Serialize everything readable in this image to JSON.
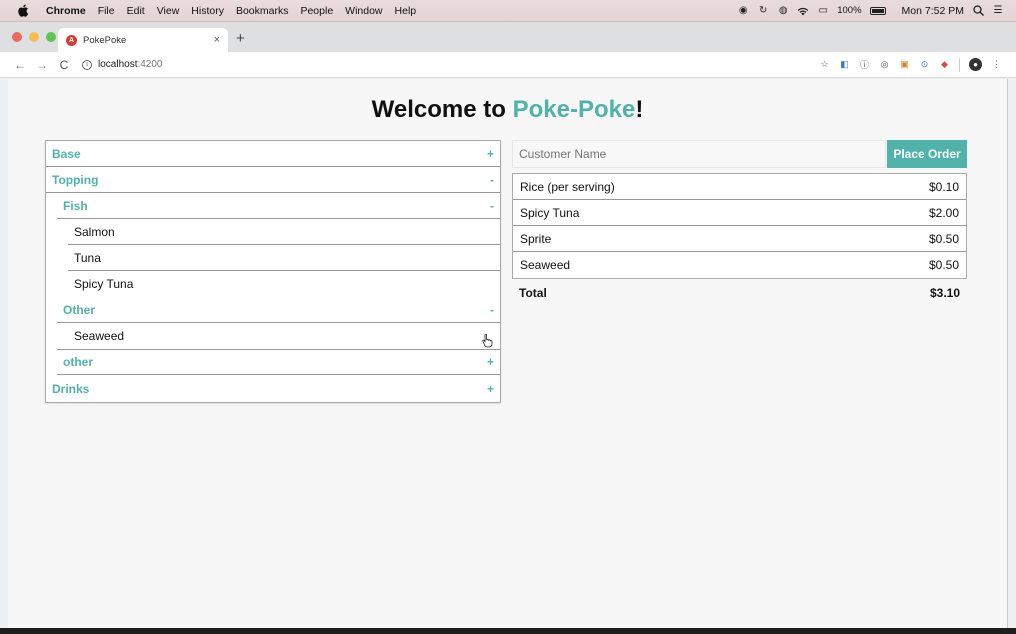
{
  "menubar": {
    "app_name": "Chrome",
    "items": [
      "File",
      "Edit",
      "View",
      "History",
      "Bookmarks",
      "People",
      "Window",
      "Help"
    ],
    "battery": "100%",
    "clock": "Mon 7:52 PM"
  },
  "browser": {
    "tab_title": "PokePoke",
    "url_host": "localhost",
    "url_port": ":4200"
  },
  "page": {
    "title_prefix": "Welcome to ",
    "title_accent": "Poke-Poke",
    "title_suffix": "!",
    "accent_color": "#4fb3a9"
  },
  "menu": {
    "base": {
      "label": "Base",
      "sign": "+"
    },
    "topping": {
      "label": "Topping",
      "sign": "-"
    },
    "fish": {
      "label": "Fish",
      "sign": "-"
    },
    "fish_items": [
      "Salmon",
      "Tuna",
      "Spicy Tuna"
    ],
    "other": {
      "label": "Other",
      "sign": "-"
    },
    "other_items": [
      "Seaweed"
    ],
    "other_lower": {
      "label": "other",
      "sign": "+"
    },
    "drinks": {
      "label": "Drinks",
      "sign": "+"
    }
  },
  "order": {
    "customer_placeholder": "Customer Name",
    "place_order_label": "Place Order",
    "lines": [
      {
        "name": "Rice (per serving)",
        "price": "$0.10"
      },
      {
        "name": "Spicy Tuna",
        "price": "$2.00"
      },
      {
        "name": "Sprite",
        "price": "$0.50"
      },
      {
        "name": "Seaweed",
        "price": "$0.50"
      }
    ],
    "total_label": "Total",
    "total_price": "$3.10"
  }
}
